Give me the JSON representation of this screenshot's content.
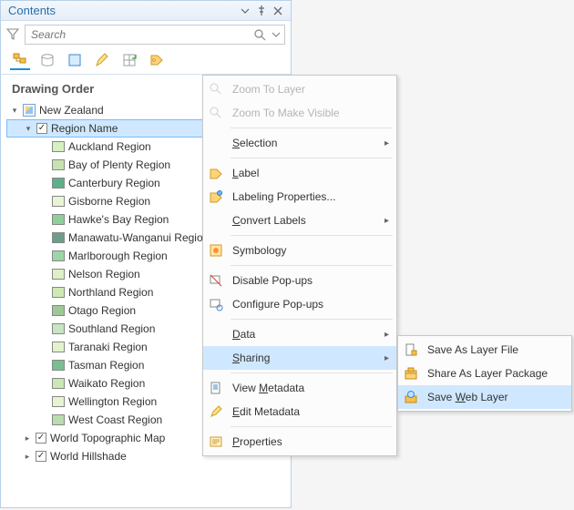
{
  "header": {
    "title": "Contents"
  },
  "search": {
    "placeholder": "Search"
  },
  "section": {
    "title": "Drawing Order"
  },
  "map": {
    "name": "New Zealand"
  },
  "layer": {
    "name": "Region Name"
  },
  "regions": [
    {
      "label": "Auckland Region",
      "color": "#d6f0c0"
    },
    {
      "label": "Bay of Plenty Region",
      "color": "#c8e2b1"
    },
    {
      "label": "Canterbury Region",
      "color": "#5eaf8a"
    },
    {
      "label": "Gisborne Region",
      "color": "#e9f5d2"
    },
    {
      "label": "Hawke's Bay Region",
      "color": "#8ecf9a"
    },
    {
      "label": "Manawatu-Wanganui Region",
      "color": "#6e9e8a"
    },
    {
      "label": "Marlborough Region",
      "color": "#9dd6a6"
    },
    {
      "label": "Nelson Region",
      "color": "#dff0c6"
    },
    {
      "label": "Northland Region",
      "color": "#cfe9b5"
    },
    {
      "label": "Otago Region",
      "color": "#9ec896"
    },
    {
      "label": "Southland Region",
      "color": "#c5e6c0"
    },
    {
      "label": "Taranaki Region",
      "color": "#e3f2cd"
    },
    {
      "label": "Tasman Region",
      "color": "#7abf92"
    },
    {
      "label": "Waikato Region",
      "color": "#cae8b4"
    },
    {
      "label": "Wellington Region",
      "color": "#e7f3d2"
    },
    {
      "label": "West Coast Region",
      "color": "#b9dcb0"
    }
  ],
  "basemaps": [
    {
      "label": "World Topographic Map"
    },
    {
      "label": "World Hillshade"
    }
  ],
  "menu": {
    "zoom_to_layer": "Zoom To Layer",
    "zoom_to_make_visible": "Zoom To Make Visible",
    "selection": "Selection",
    "label": "Label",
    "labeling_props": "Labeling Properties...",
    "convert_labels": "Convert Labels",
    "symbology": "Symbology",
    "disable_popups": "Disable Pop-ups",
    "configure_popups": "Configure Pop-ups",
    "data": "Data",
    "sharing": "Sharing",
    "view_metadata": "View Metadata",
    "edit_metadata": "Edit Metadata",
    "properties": "Properties"
  },
  "submenu": {
    "save_as_layer_file": "Save As Layer File",
    "share_as_layer_package": "Share As Layer Package",
    "save_web_layer": "Save Web Layer"
  },
  "underline": {
    "selection": "S",
    "label": "L",
    "convert": "C",
    "data": "D",
    "sharing": "S",
    "metadata": "M",
    "edit": "E",
    "properties": "P",
    "web": "W"
  }
}
